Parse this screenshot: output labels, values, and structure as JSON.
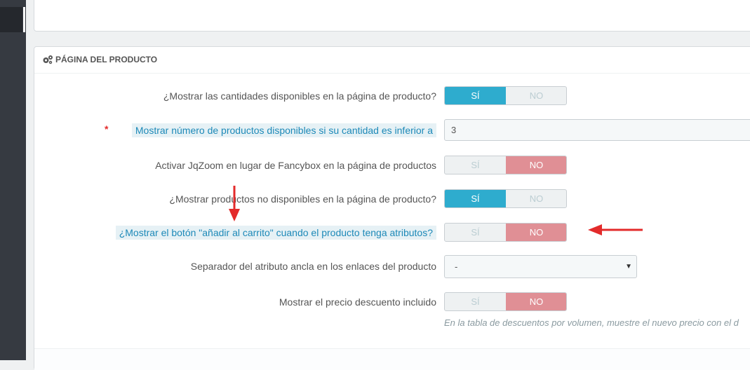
{
  "section": {
    "title": "PÁGINA DEL PRODUCTO",
    "icon": "cogs-icon"
  },
  "fields": {
    "show_quantities": {
      "label": "¿Mostrar las cantidades disponibles en la página de producto?",
      "yes": "SÍ",
      "no": "NO",
      "value": "SÍ"
    },
    "low_stock": {
      "required_mark": "*",
      "label": "Mostrar número de productos disponibles si su cantidad es inferior a",
      "value": "3"
    },
    "jqzoom": {
      "label": "Activar JqZoom en lugar de Fancybox en la página de productos",
      "yes": "SÍ",
      "no": "NO",
      "value": "NO"
    },
    "show_unavailable": {
      "label": "¿Mostrar productos no disponibles en la página de producto?",
      "yes": "SÍ",
      "no": "NO",
      "value": "SÍ"
    },
    "add_to_cart_attributes": {
      "label": "¿Mostrar el botón \"añadir al carrito\" cuando el producto tenga atributos?",
      "yes": "SÍ",
      "no": "NO",
      "value": "NO"
    },
    "anchor_separator": {
      "label": "Separador del atributo ancla en los enlaces del producto",
      "value": "-"
    },
    "show_discount_price": {
      "label": "Mostrar el precio descuento incluido",
      "yes": "SÍ",
      "no": "NO",
      "value": "NO",
      "help": "En la tabla de descuentos por volumen, muestre el nuevo precio con el d"
    }
  },
  "colors": {
    "accent": "#2eacce",
    "no_active": "#e08f95",
    "annotation_arrow": "#e32b2b",
    "sidebar": "#363a41"
  }
}
